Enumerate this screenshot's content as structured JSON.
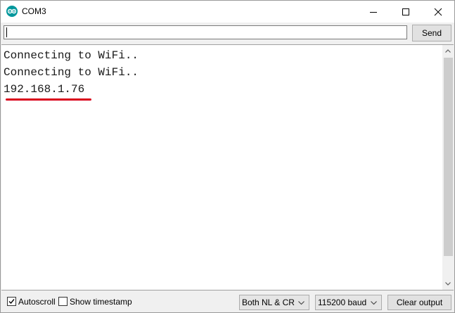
{
  "window": {
    "title": "COM3",
    "app_icon": "arduino-logo-icon",
    "controls": [
      "minimize-icon",
      "maximize-icon",
      "close-icon"
    ]
  },
  "input": {
    "value": "",
    "send_label": "Send"
  },
  "output": {
    "lines": [
      "Connecting to WiFi..",
      "Connecting to WiFi..",
      "192.168.1.76"
    ],
    "highlight_color": "#d9001b"
  },
  "bottom": {
    "autoscroll": {
      "label": "Autoscroll",
      "checked": true
    },
    "timestamp": {
      "label": "Show timestamp",
      "checked": false
    },
    "line_ending": "Both NL & CR",
    "baud_rate": "115200 baud",
    "clear_label": "Clear output"
  },
  "colors": {
    "accent": "#00979c"
  }
}
